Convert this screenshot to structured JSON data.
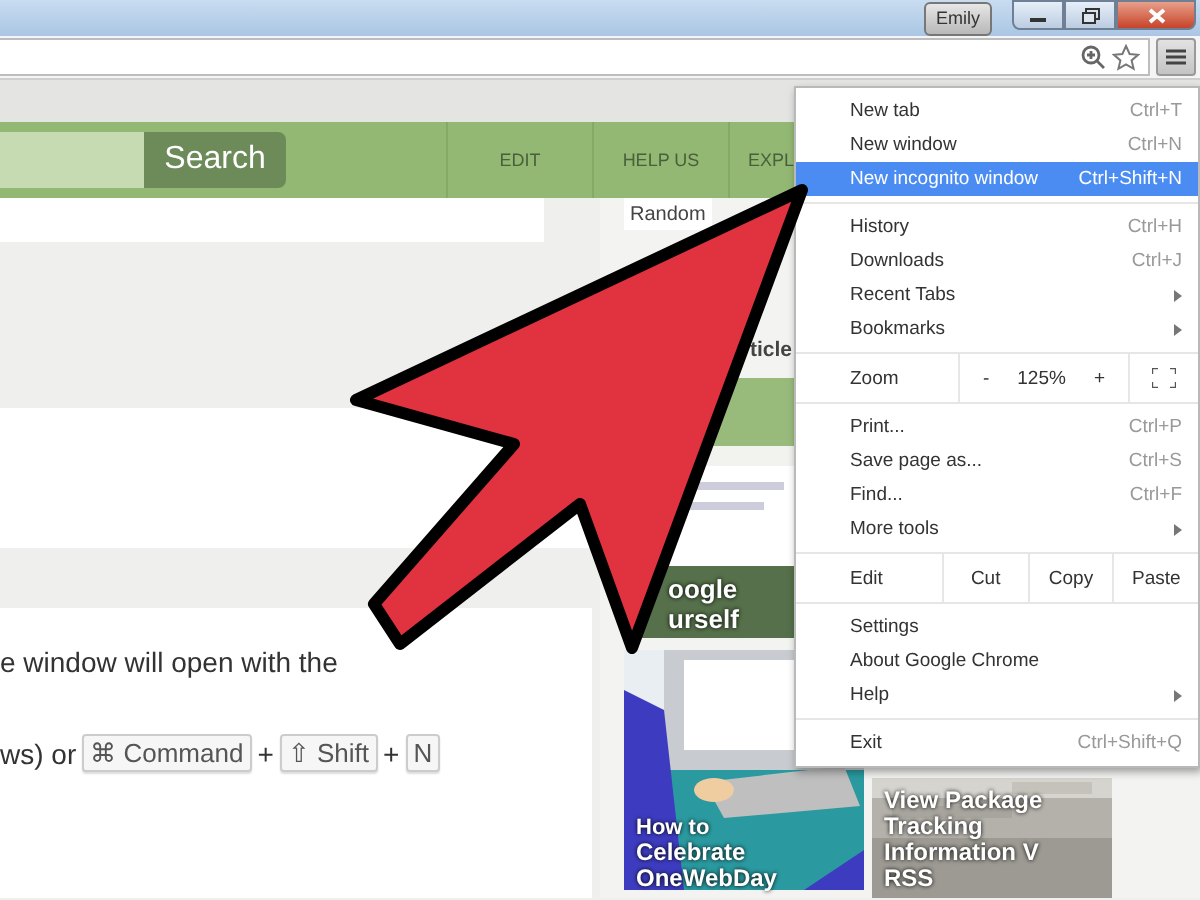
{
  "window": {
    "user": "Emily"
  },
  "site_nav": {
    "search_button": "Search",
    "links": [
      {
        "label": "EDIT"
      },
      {
        "label": "HELP US"
      },
      {
        "label": "EXPL"
      }
    ]
  },
  "article": {
    "lines": [
      [
        {
          "kind": "text",
          "text": "e window will open with the"
        }
      ],
      [
        {
          "kind": "text",
          "text": "ws) or"
        },
        {
          "kind": "key",
          "text": "⌘ Command"
        },
        {
          "kind": "text",
          "text": "+"
        },
        {
          "kind": "key",
          "text": "⇧ Shift"
        },
        {
          "kind": "text",
          "text": "+"
        },
        {
          "kind": "key",
          "text": "N"
        }
      ]
    ]
  },
  "sidebar": {
    "random_button": "Random",
    "heading": "ticle",
    "tiles": [
      {
        "title": [
          "oogle",
          "urself"
        ]
      },
      {
        "kicker": "How to",
        "title": [
          "Celebrate",
          "OneWebDay"
        ]
      },
      {
        "title": [
          "View Package",
          "Tracking",
          "Information V",
          "RSS"
        ]
      }
    ]
  },
  "menu": {
    "groups": [
      [
        {
          "kind": "item",
          "label": "New tab",
          "shortcut": "Ctrl+T",
          "submenu": false,
          "selected": false
        },
        {
          "kind": "item",
          "label": "New window",
          "shortcut": "Ctrl+N",
          "submenu": false,
          "selected": false
        },
        {
          "kind": "item",
          "label": "New incognito window",
          "shortcut": "Ctrl+Shift+N",
          "submenu": false,
          "selected": true
        }
      ],
      [
        {
          "kind": "item",
          "label": "History",
          "shortcut": "Ctrl+H",
          "submenu": false,
          "selected": false
        },
        {
          "kind": "item",
          "label": "Downloads",
          "shortcut": "Ctrl+J",
          "submenu": false,
          "selected": false
        },
        {
          "kind": "item",
          "label": "Recent Tabs",
          "submenu": true,
          "selected": false
        },
        {
          "kind": "item",
          "label": "Bookmarks",
          "submenu": true,
          "selected": false
        }
      ],
      [
        {
          "kind": "zoom",
          "label": "Zoom",
          "minus": "-",
          "value": "125%",
          "plus": "+"
        }
      ],
      [
        {
          "kind": "item",
          "label": "Print...",
          "shortcut": "Ctrl+P",
          "submenu": false,
          "selected": false
        },
        {
          "kind": "item",
          "label": "Save page as...",
          "shortcut": "Ctrl+S",
          "submenu": false,
          "selected": false
        },
        {
          "kind": "item",
          "label": "Find...",
          "shortcut": "Ctrl+F",
          "submenu": false,
          "selected": false
        },
        {
          "kind": "item",
          "label": "More tools",
          "submenu": true,
          "selected": false
        }
      ],
      [
        {
          "kind": "edit",
          "label": "Edit",
          "buttons": [
            "Cut",
            "Copy",
            "Paste"
          ]
        }
      ],
      [
        {
          "kind": "item",
          "label": "Settings",
          "submenu": false,
          "selected": false
        },
        {
          "kind": "item",
          "label": "About Google Chrome",
          "submenu": false,
          "selected": false
        },
        {
          "kind": "item",
          "label": "Help",
          "submenu": true,
          "selected": false
        }
      ],
      [
        {
          "kind": "item",
          "label": "Exit",
          "shortcut": "Ctrl+Shift+Q",
          "submenu": false,
          "selected": false
        }
      ]
    ]
  }
}
